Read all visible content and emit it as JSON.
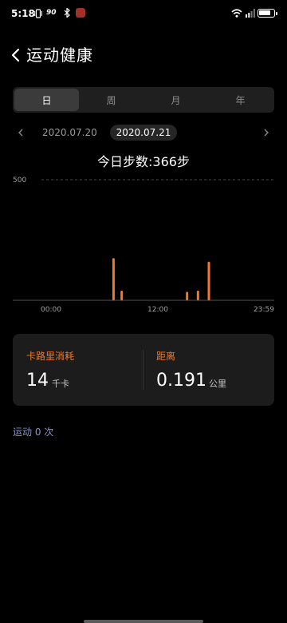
{
  "status_bar": {
    "time": "5:18",
    "net_speed": "90",
    "battery_level": 0.85
  },
  "header": {
    "title": "运动健康"
  },
  "tabs": [
    {
      "label": "日",
      "active": true
    },
    {
      "label": "周",
      "active": false
    },
    {
      "label": "月",
      "active": false
    },
    {
      "label": "年",
      "active": false
    }
  ],
  "date_nav": {
    "prev_date": "2020.07.20",
    "current_date": "2020.07.21"
  },
  "summary": {
    "steps_text": "今日步数:366步"
  },
  "chart_data": {
    "type": "bar",
    "y_max_label": "500",
    "ylim": [
      0,
      500
    ],
    "x_tick_labels": [
      "00:00",
      "12:00",
      "23:59"
    ],
    "x_range_hours": [
      0,
      24
    ],
    "bar_color": "#f3792a",
    "bars": [
      {
        "hour": 9.25,
        "value": 175
      },
      {
        "hour": 10.0,
        "value": 40
      },
      {
        "hour": 16.0,
        "value": 35
      },
      {
        "hour": 17.0,
        "value": 40
      },
      {
        "hour": 18.0,
        "value": 160
      }
    ]
  },
  "stats": {
    "calories": {
      "label": "卡路里消耗",
      "value": "14",
      "unit": "千卡"
    },
    "distance": {
      "label": "距离",
      "value": "0.191",
      "unit": "公里"
    }
  },
  "workout": {
    "text": "运动 0 次"
  },
  "colors": {
    "accent": "#f3792a",
    "workout_text": "#8a93c7"
  }
}
